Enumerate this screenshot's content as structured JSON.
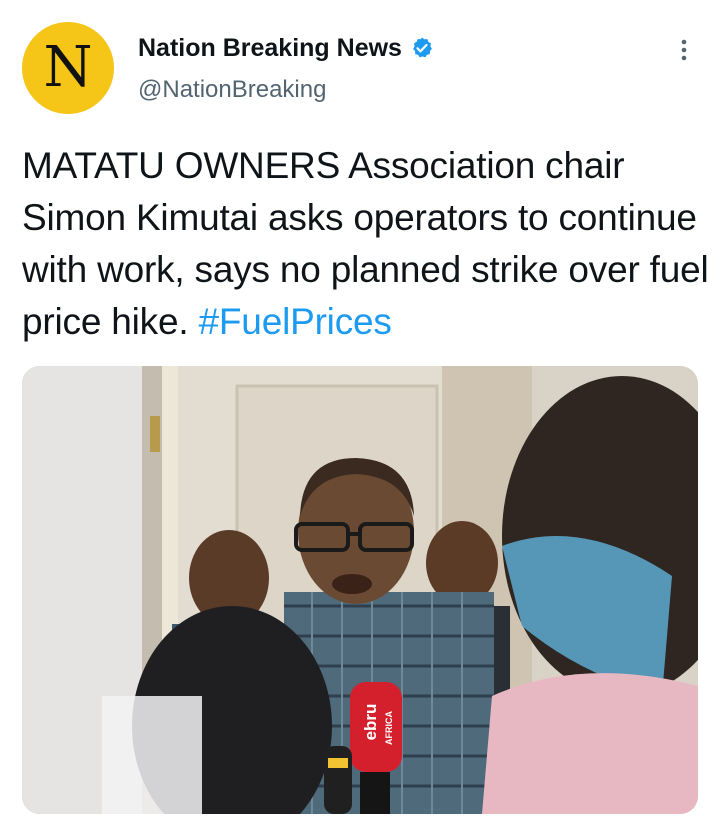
{
  "account": {
    "display_name": "Nation Breaking News",
    "handle": "@NationBreaking",
    "avatar_letter": "N",
    "verified": true,
    "avatar_color": "#f5c518",
    "verified_color": "#1d9bf0"
  },
  "tweet": {
    "text": "MATATU OWNERS Association chair Simon Kimutai asks operators to continue with work, says no planned strike over fuel price hike.",
    "hashtag": "#FuelPrices"
  },
  "media": {
    "mic_brand_text": "ebru",
    "mic_sub_text": "AFRICA"
  },
  "icons": {
    "more": "more-vertical-icon",
    "verified": "verified-badge-icon"
  }
}
